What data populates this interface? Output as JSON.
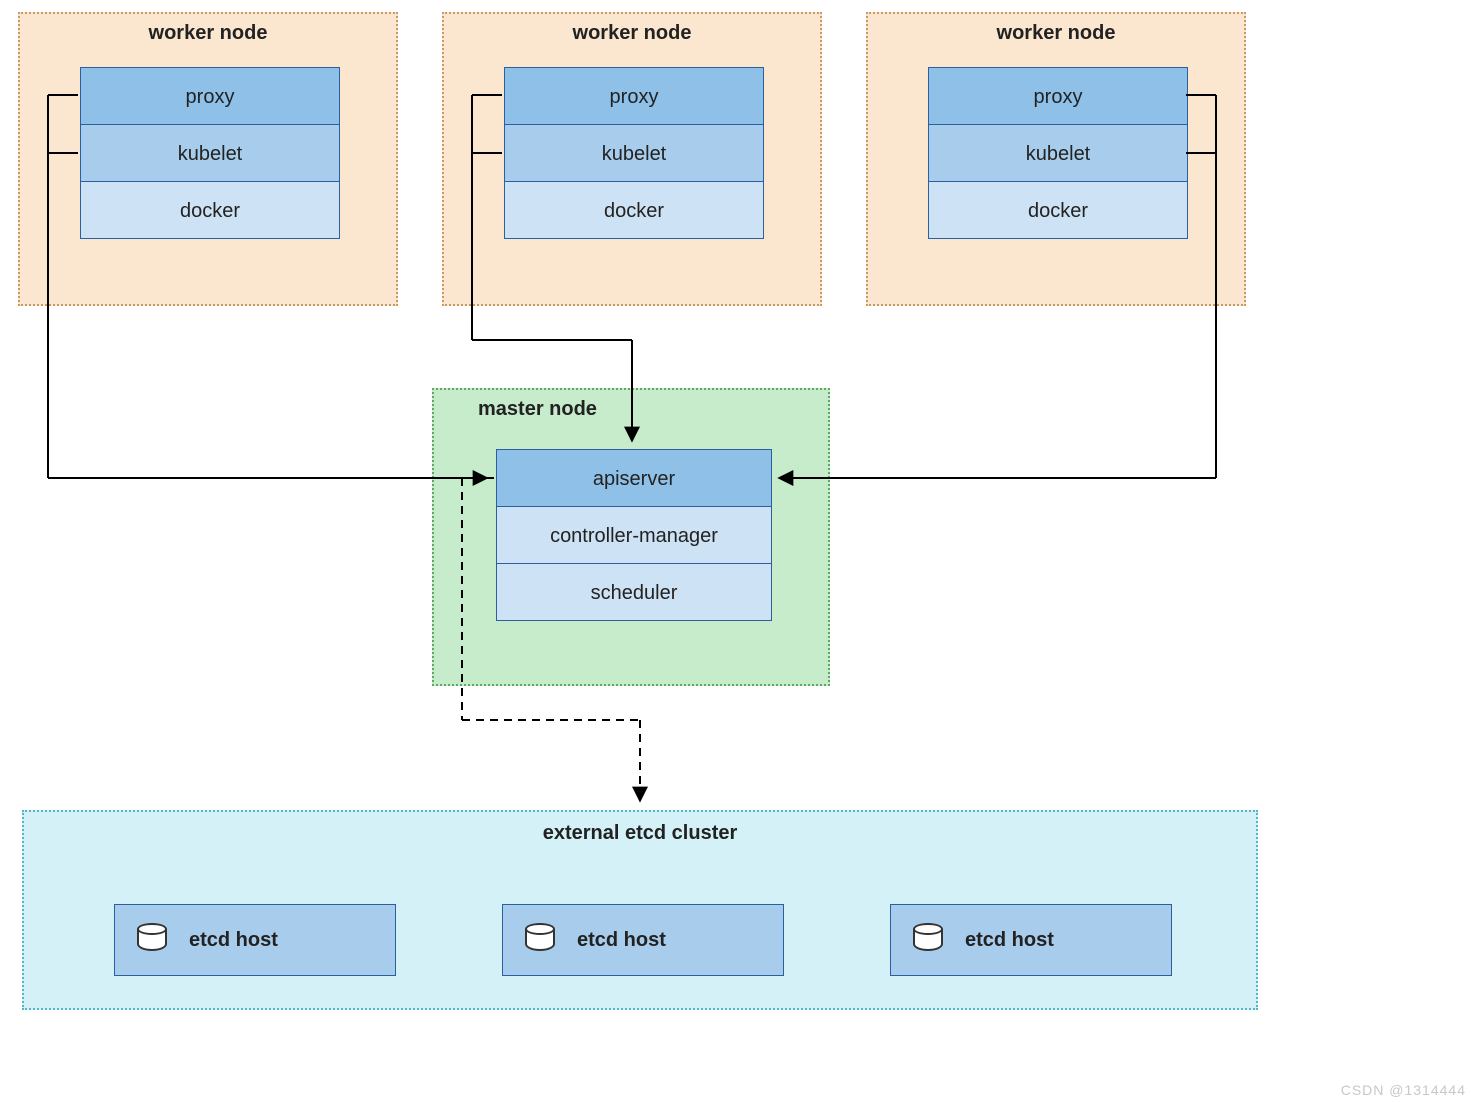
{
  "workers": [
    {
      "title": "worker node",
      "components": [
        "proxy",
        "kubelet",
        "docker"
      ]
    },
    {
      "title": "worker node",
      "components": [
        "proxy",
        "kubelet",
        "docker"
      ]
    },
    {
      "title": "worker node",
      "components": [
        "proxy",
        "kubelet",
        "docker"
      ]
    }
  ],
  "master": {
    "title": "master node",
    "components": [
      "apiserver",
      "controller-manager",
      "scheduler"
    ]
  },
  "etcd": {
    "title": "external etcd cluster",
    "hosts": [
      "etcd host",
      "etcd host",
      "etcd host"
    ]
  },
  "watermark": "CSDN @1314444",
  "colors": {
    "worker_bg": "#fbe6cf",
    "worker_border": "#cc9966",
    "master_bg": "#c7eccb",
    "master_border": "#5ea864",
    "etcd_bg": "#d3f1f6",
    "etcd_border": "#5ab3c4",
    "box_dark": "#8fc1e8",
    "box_mid": "#a8cdec",
    "box_light": "#cde2f4",
    "box_border": "#2b5f9e"
  }
}
